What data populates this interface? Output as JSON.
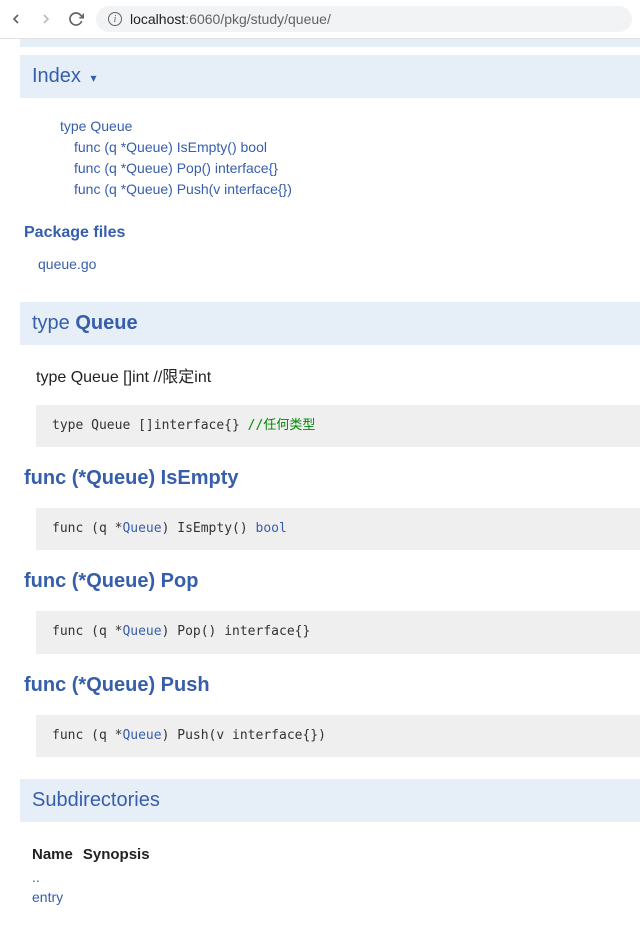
{
  "browser": {
    "url_host": "localhost",
    "url_port": ":6060",
    "url_path": "/pkg/study/queue/"
  },
  "sections": {
    "index": {
      "label": "Index",
      "items": [
        {
          "label": "type Queue",
          "indent": false
        },
        {
          "label": "func (q *Queue) IsEmpty() bool",
          "indent": true
        },
        {
          "label": "func (q *Queue) Pop() interface{}",
          "indent": true
        },
        {
          "label": "func (q *Queue) Push(v interface{})",
          "indent": true
        }
      ]
    },
    "package_files": {
      "title": "Package files",
      "files": [
        "queue.go"
      ]
    },
    "type_queue": {
      "kw": "type",
      "name": "Queue",
      "desc": "type Queue []int //限定int",
      "code_prefix": "type Queue []interface{} ",
      "code_comment": "//任何类型"
    },
    "func_isempty": {
      "title": "func (*Queue) IsEmpty",
      "code_pre": "func (q *",
      "code_type": "Queue",
      "code_mid": ") IsEmpty() ",
      "code_ret": "bool"
    },
    "func_pop": {
      "title": "func (*Queue) Pop",
      "code_pre": "func (q *",
      "code_type": "Queue",
      "code_post": ") Pop() interface{}"
    },
    "func_push": {
      "title": "func (*Queue) Push",
      "code_pre": "func (q *",
      "code_type": "Queue",
      "code_post": ") Push(v interface{})"
    },
    "subdirectories": {
      "title": "Subdirectories",
      "headers": {
        "name": "Name",
        "synopsis": "Synopsis"
      },
      "rows": [
        {
          "name": "..",
          "synopsis": ""
        },
        {
          "name": "entry",
          "synopsis": ""
        }
      ]
    }
  }
}
